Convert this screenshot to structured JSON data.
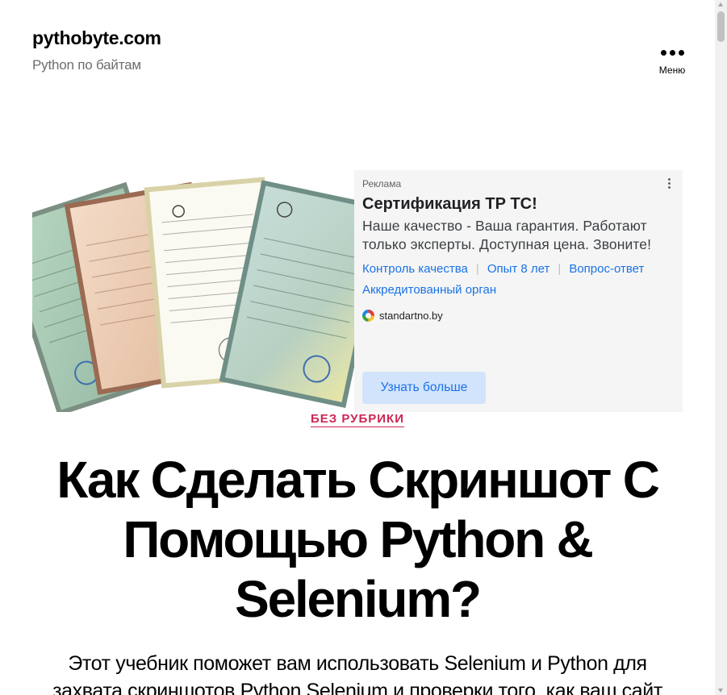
{
  "site": {
    "title": "pythobyte.com",
    "description": "Python по байтам"
  },
  "menu": {
    "label": "Меню",
    "icon": "more-dots-icon"
  },
  "ad": {
    "label": "Реклама",
    "title": "Сертификация ТР ТС!",
    "text": "Наше качество - Ваша гарантия. Работают только эксперты. Доступная цена. Звоните!",
    "links": [
      "Контроль качества",
      "Опыт 8 лет",
      "Вопрос-ответ",
      "Аккредитованный орган"
    ],
    "domain": "standartno.by",
    "cta": "Узнать больше",
    "colors": {
      "link": "#1a73e8",
      "cta_bg": "#d2e3fc",
      "background": "#f5f5f5"
    }
  },
  "post": {
    "category": "БЕЗ РУБРИКИ",
    "title": "Как Сделать Скриншот С Помощью Python & Selenium?",
    "intro": "Этот учебник поможет вам использовать Selenium и Python для захвата скриншотов Python Selenium и проверки того, как ваш сайт"
  },
  "colors": {
    "accent": "#cd2653",
    "text": "#000000",
    "muted": "#6d6d6d"
  }
}
